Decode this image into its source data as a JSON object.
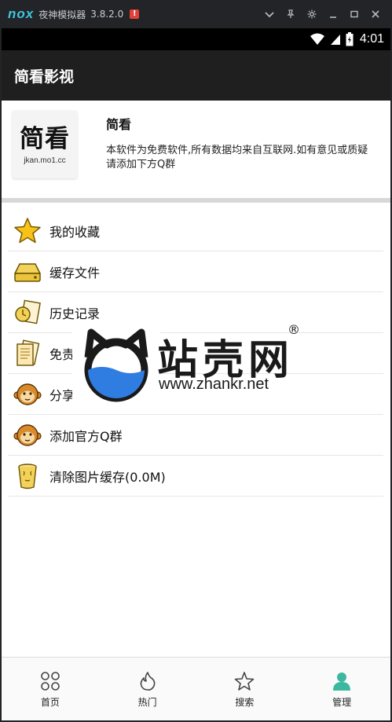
{
  "emulator": {
    "logo": "nox",
    "title": "夜神模拟器",
    "version": "3.8.2.0",
    "alert_badge": "!"
  },
  "status_bar": {
    "time": "4:01"
  },
  "app": {
    "title": "简看影视"
  },
  "profile": {
    "logo_text": "简看",
    "logo_domain": "jkan.mo1.cc",
    "name": "简看",
    "description": "本软件为免费软件,所有数据均来自互联网.如有意见或质疑请添加下方Q群"
  },
  "menu": {
    "items": [
      {
        "label": "我的收藏",
        "icon": "star-icon"
      },
      {
        "label": "缓存文件",
        "icon": "disk-drive-icon"
      },
      {
        "label": "历史记录",
        "icon": "history-clock-icon"
      },
      {
        "label": "免责声明",
        "icon": "document-icon"
      },
      {
        "label": "分享",
        "icon": "monkey-face-icon"
      },
      {
        "label": "添加官方Q群",
        "icon": "monkey-face-icon"
      },
      {
        "label": "清除图片缓存(0.0M)",
        "icon": "trash-bin-icon"
      }
    ]
  },
  "watermark": {
    "brand": "站壳网",
    "registered": "®",
    "url": "www.zhankr.net"
  },
  "bottom_nav": {
    "items": [
      {
        "label": "首页",
        "icon": "home-grid-icon"
      },
      {
        "label": "热门",
        "icon": "flame-icon"
      },
      {
        "label": "搜索",
        "icon": "star-outline-icon"
      },
      {
        "label": "管理",
        "icon": "user-icon"
      }
    ]
  },
  "colors": {
    "header_bg": "#1f1f1f",
    "emulator_accent": "#3ec6e0",
    "watermark_blue": "#2f7de1"
  }
}
